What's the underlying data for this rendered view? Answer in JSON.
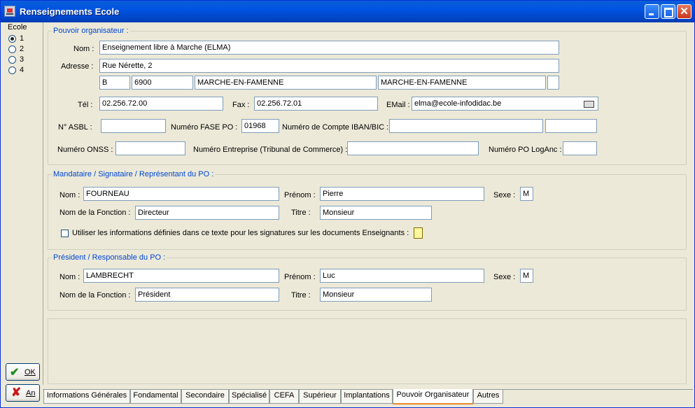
{
  "window": {
    "title": "Renseignements Ecole"
  },
  "school_selector": {
    "label": "Ecole",
    "options": [
      "1",
      "2",
      "3",
      "4"
    ],
    "selected": "1"
  },
  "po": {
    "title": "Pouvoir organisateur :",
    "nom_label": "Nom :",
    "nom": "Enseignement libre à Marche (ELMA)",
    "adresse_label": "Adresse :",
    "adresse": "Rue Nérette, 2",
    "pays": "B",
    "cp": "6900",
    "localite": "MARCHE-EN-FAMENNE",
    "commune": "MARCHE-EN-FAMENNE",
    "extra": "",
    "tel_label": "Tél :",
    "tel": "02.256.72.00",
    "fax_label": "Fax :",
    "fax": "02.256.72.01",
    "email_label": "EMail :",
    "email": "elma@ecole-infodidac.be",
    "asbl_label": "N° ASBL :",
    "asbl": "",
    "fase_label": "Numéro FASE PO :",
    "fase": "01968",
    "compte_label": "Numéro de Compte  IBAN/BIC :",
    "iban": "",
    "bic": "",
    "onss_label": "Numéro ONSS :",
    "onss": "",
    "entreprise_label": "Numéro Entreprise (Tribunal de Commerce) :",
    "entreprise": "",
    "logan_label": "Numéro PO LogAnc :",
    "logan": ""
  },
  "mandataire": {
    "title": "Mandataire / Signataire / Représentant du PO :",
    "nom_label": "Nom :",
    "nom": "FOURNEAU",
    "prenom_label": "Prénom :",
    "prenom": "Pierre",
    "sexe_label": "Sexe :",
    "sexe": "M",
    "fonction_label": "Nom de la Fonction :",
    "fonction": "Directeur",
    "titre_label": "Titre :",
    "titre": "Monsieur",
    "checkbox_label": "Utiliser les informations définies dans ce texte pour les signatures sur les documents Enseignants :"
  },
  "president": {
    "title": "Président / Responsable du PO :",
    "nom_label": "Nom :",
    "nom": "LAMBRECHT",
    "prenom_label": "Prénom :",
    "prenom": "Luc",
    "sexe_label": "Sexe :",
    "sexe": "M",
    "fonction_label": "Nom de la Fonction :",
    "fonction": "Président",
    "titre_label": "Titre :",
    "titre": "Monsieur"
  },
  "buttons": {
    "ok": "OK",
    "annuler": "An"
  },
  "tabs": [
    {
      "label": "Informations Générales"
    },
    {
      "label": "Fondamental"
    },
    {
      "label": "Secondaire"
    },
    {
      "label": "Spécialisé"
    },
    {
      "label": "CEFA"
    },
    {
      "label": "Supérieur"
    },
    {
      "label": "Implantations"
    },
    {
      "label": "Pouvoir Organisateur",
      "active": true
    },
    {
      "label": "Autres"
    }
  ],
  "colors": {
    "titlebar": "#0053e1",
    "group_title": "#0046d5",
    "window_bg": "#ece9d8",
    "active_tab_accent": "#e68b2c"
  }
}
